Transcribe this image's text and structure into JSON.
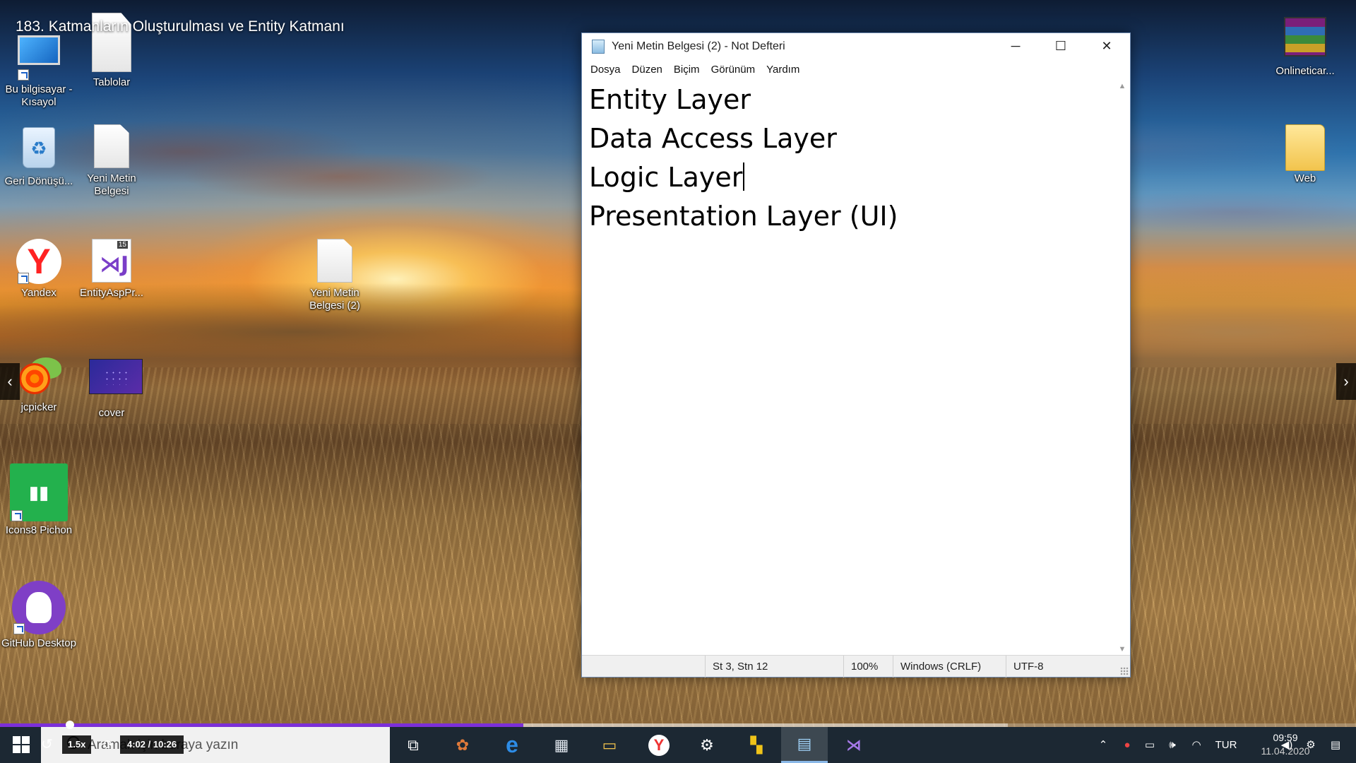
{
  "video": {
    "title": "183. Katmanların Oluşturulması ve Entity Katmanı",
    "speed": "1.5x",
    "time": "4:02 / 10:26",
    "progress_fraction": 0.386,
    "buffered_fraction": 0.743
  },
  "desktop_icons": [
    {
      "label": "Bu bilgisayar - Kısayol",
      "icon": "computer-icon"
    },
    {
      "label": "Tablolar",
      "icon": "document-icon"
    },
    {
      "label": "Geri Dönüşü...",
      "icon": "recycle-bin-icon"
    },
    {
      "label": "Yeni Metin Belgesi",
      "icon": "text-document-icon"
    },
    {
      "label": "Yandex",
      "icon": "yandex-browser-icon",
      "glyph": "Y"
    },
    {
      "label": "EntityAspPr...",
      "icon": "visual-studio-solution-icon",
      "glyph": "⋊J",
      "badge": "15"
    },
    {
      "label": "Yeni Metin Belgesi (2)",
      "icon": "text-document-icon"
    },
    {
      "label": "jcpicker",
      "icon": "jcpicker-icon"
    },
    {
      "label": "cover",
      "icon": "image-icon"
    },
    {
      "label": "Icons8 Pichon",
      "icon": "icons8-pichon-icon"
    },
    {
      "label": "GitHub Desktop",
      "icon": "github-desktop-icon"
    },
    {
      "label": "Onlineticar...",
      "icon": "winrar-archive-icon"
    },
    {
      "label": "Web",
      "icon": "folder-icon"
    }
  ],
  "notepad": {
    "title": "Yeni Metin Belgesi (2) - Not Defteri",
    "controls": {
      "minimize": "─",
      "maximize": "☐",
      "close": "✕"
    },
    "menu": [
      "Dosya",
      "Düzen",
      "Biçim",
      "Görünüm",
      "Yardım"
    ],
    "lines": [
      "Entity Layer",
      "Data Access Layer",
      "Logic Layer",
      "Presentation Layer (UI)"
    ],
    "status": {
      "position": "St 3, Stn 12",
      "zoom": "100%",
      "line_ending": "Windows (CRLF)",
      "encoding": "UTF-8"
    }
  },
  "taskbar": {
    "search_placeholder": "Aramak için buraya yazın",
    "apps": [
      {
        "icon": "task-view-icon",
        "glyph": "⧉"
      },
      {
        "icon": "paint-app-icon",
        "glyph": "✿"
      },
      {
        "icon": "edge-browser-icon",
        "glyph": "e"
      },
      {
        "icon": "store-icon",
        "glyph": "▦"
      },
      {
        "icon": "file-explorer-icon",
        "glyph": "▭"
      },
      {
        "icon": "yandex-browser-icon",
        "glyph": "Y"
      },
      {
        "icon": "settings-gear-icon",
        "glyph": "⚙"
      },
      {
        "icon": "sticky-notes-icon",
        "glyph": "▚"
      },
      {
        "icon": "notepad-icon",
        "glyph": "▤"
      },
      {
        "icon": "visual-studio-icon",
        "glyph": "⋊"
      }
    ],
    "tray": {
      "language": "TUR",
      "time": "09:59",
      "date": "11.04.2020"
    }
  },
  "colors": {
    "progress": "#7c2fd8",
    "taskbar": "#1c2833",
    "notepad_status": "#f0f0f0"
  }
}
